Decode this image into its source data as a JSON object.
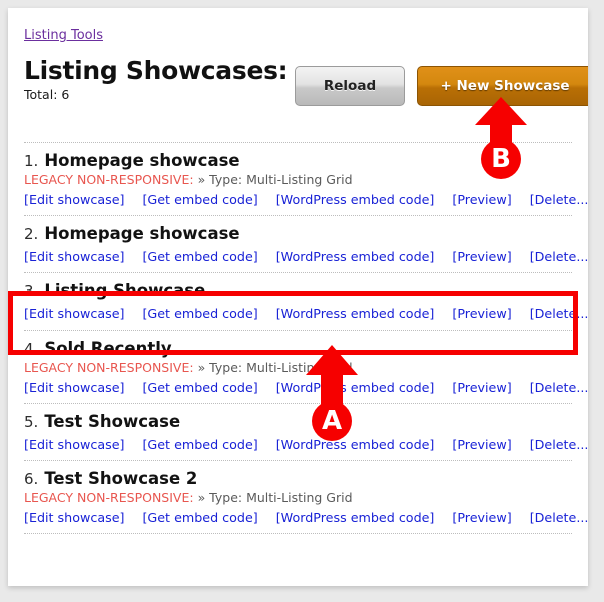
{
  "breadcrumb": {
    "label": "Listing Tools"
  },
  "header": {
    "title": "Listing Showcases:",
    "total_label": "Total: 6",
    "reload_label": "Reload",
    "new_showcase_label": "+ New Showcase"
  },
  "links": {
    "edit": "[Edit showcase]",
    "embed": "[Get embed code]",
    "wordpress": "[WordPress embed code]",
    "preview": "[Preview]",
    "delete": "[Delete...]"
  },
  "list": {
    "items": [
      {
        "index": "1.",
        "name": "Homepage showcase",
        "legacy": "LEGACY NON-RESPONSIVE:",
        "type": "» Type: Multi-Listing Grid",
        "has_meta": true,
        "highlighted": false
      },
      {
        "index": "2.",
        "name": "Homepage showcase",
        "legacy": "",
        "type": "",
        "has_meta": false,
        "highlighted": false
      },
      {
        "index": "3.",
        "name": "Listing Showcase",
        "legacy": "",
        "type": "",
        "has_meta": false,
        "highlighted": true
      },
      {
        "index": "4.",
        "name": "Sold Recently",
        "legacy": "LEGACY NON-RESPONSIVE:",
        "type": "» Type: Multi-Listing Grid",
        "has_meta": true,
        "highlighted": false
      },
      {
        "index": "5.",
        "name": "Test Showcase",
        "legacy": "",
        "type": "",
        "has_meta": false,
        "highlighted": false
      },
      {
        "index": "6.",
        "name": "Test Showcase 2",
        "legacy": "LEGACY NON-RESPONSIVE:",
        "type": "» Type: Multi-Listing Grid",
        "has_meta": true,
        "highlighted": false
      }
    ]
  },
  "annotations": {
    "marker_a": "A",
    "marker_b": "B"
  },
  "colors": {
    "accent_orange": "#c07a08",
    "link_blue": "#1922d6",
    "visited_purple": "#6b2f9e",
    "legacy_red": "#e8564f",
    "annotation_red": "#f60000"
  }
}
